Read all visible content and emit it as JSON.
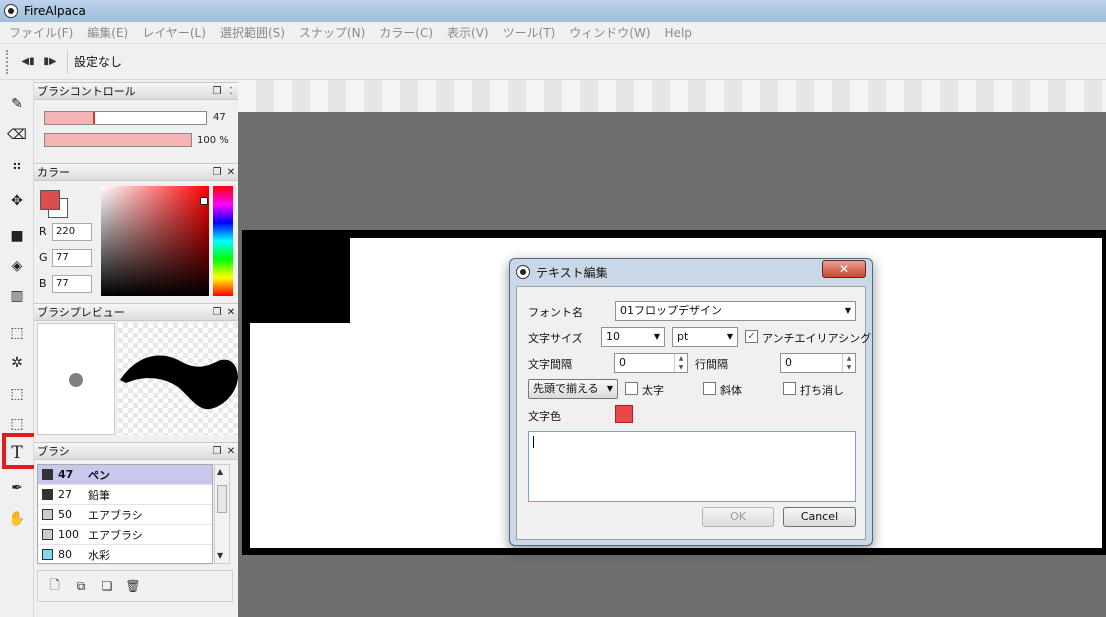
{
  "window": {
    "title": "FireAlpaca"
  },
  "menu": [
    "ファイル(F)",
    "編集(E)",
    "レイヤー(L)",
    "選択範囲(S)",
    "スナップ(N)",
    "カラー(C)",
    "表示(V)",
    "ツール(T)",
    "ウィンドウ(W)",
    "Help"
  ],
  "toolbar": {
    "snap_label": "設定なし",
    "prev_icon": "◀▮",
    "next_icon": "▮▶"
  },
  "tools": [
    {
      "name": "pen-tool-icon",
      "glyph": "✎"
    },
    {
      "name": "eraser-tool-icon",
      "glyph": "⌫"
    },
    {
      "name": "dot-tool-icon",
      "glyph": "⠶"
    },
    {
      "name": "move-tool-icon",
      "glyph": "✥"
    },
    {
      "name": "fill-rect-tool-icon",
      "glyph": "■"
    },
    {
      "name": "bucket-tool-icon",
      "glyph": "◈"
    },
    {
      "name": "gradient-tool-icon",
      "glyph": "▥"
    },
    {
      "name": "select-tool-icon",
      "glyph": "⬚"
    },
    {
      "name": "magic-wand-tool-icon",
      "glyph": "✲"
    },
    {
      "name": "selection-pen-tool-icon",
      "glyph": "⬚"
    },
    {
      "name": "selection-eraser-tool-icon",
      "glyph": "⬚"
    },
    {
      "name": "text-tool-icon",
      "glyph": "T"
    },
    {
      "name": "eyedropper-tool-icon",
      "glyph": "✒"
    },
    {
      "name": "hand-tool-icon",
      "glyph": "✋"
    }
  ],
  "brush_control": {
    "title": "ブラシコントロール",
    "size_value": "47",
    "opacity_value": "100 %",
    "size_fraction": 0.3,
    "opacity_fraction": 1.0
  },
  "color_panel": {
    "title": "カラー",
    "r_label": "R",
    "g_label": "G",
    "b_label": "B",
    "r": "220",
    "g": "77",
    "b": "77",
    "fg_color": "#dc4d4d"
  },
  "brush_preview": {
    "title": "ブラシプレビュー"
  },
  "brush_panel": {
    "title": "ブラシ",
    "items": [
      {
        "size": "47",
        "name": "ペン",
        "color": "#333333",
        "selected": true
      },
      {
        "size": "27",
        "name": "鉛筆",
        "color": "#333333",
        "selected": false
      },
      {
        "size": "50",
        "name": "エアブラシ",
        "color": "#cccccc",
        "selected": false
      },
      {
        "size": "100",
        "name": "エアブラシ",
        "color": "#cccccc",
        "selected": false
      },
      {
        "size": "80",
        "name": "水彩",
        "color": "#7fd8f5",
        "selected": false
      }
    ]
  },
  "dialog": {
    "title": "テキスト編集",
    "close_label": "✕",
    "font_label": "フォント名",
    "font_value": "01フロップデザイン",
    "size_label": "文字サイズ",
    "size_value": "10",
    "unit_value": "pt",
    "antialias_label": "アンチエイリアシング",
    "antialias_checked": "✓",
    "char_spacing_label": "文字間隔",
    "char_spacing_value": "0",
    "line_spacing_label": "行間隔",
    "line_spacing_value": "0",
    "align_value": "先頭で揃える",
    "bold_label": "太字",
    "italic_label": "斜体",
    "strike_label": "打ち消し",
    "color_label": "文字色",
    "text_color": "#e74848",
    "ok_label": "OK",
    "cancel_label": "Cancel"
  },
  "colors": {
    "accent_red": "#e21c1c",
    "selected_brush": "#c8c8ef"
  }
}
